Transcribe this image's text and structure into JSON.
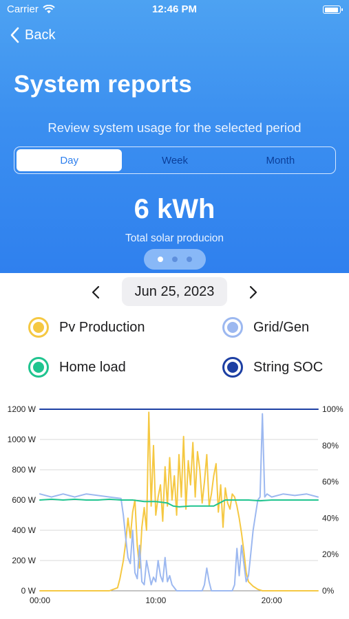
{
  "status_bar": {
    "carrier": "Carrier",
    "time": "12:46 PM"
  },
  "nav": {
    "back_label": "Back"
  },
  "header": {
    "title": "System reports",
    "subtitle": "Review system usage for the selected period"
  },
  "period_tabs": [
    {
      "label": "Day",
      "selected": true
    },
    {
      "label": "Week",
      "selected": false
    },
    {
      "label": "Month",
      "selected": false
    }
  ],
  "summary": {
    "value": "6 kWh",
    "caption": "Total solar producion",
    "page_index": 0,
    "page_count": 3
  },
  "date_picker": {
    "date": "Jun 25, 2023"
  },
  "legend": [
    {
      "label": "Pv Production",
      "color": "#f5c842"
    },
    {
      "label": "Grid/Gen",
      "color": "#9cb8f0"
    },
    {
      "label": "Home load",
      "color": "#1fc48f"
    },
    {
      "label": "String SOC",
      "color": "#1d3fa3"
    }
  ],
  "chart_data": {
    "type": "line",
    "title": "",
    "x_ticks": [
      "00:00",
      "10:00",
      "20:00"
    ],
    "xlim": [
      0,
      24
    ],
    "y_left_ticks": [
      "0 W",
      "200 W",
      "400 W",
      "600 W",
      "800 W",
      "1000 W",
      "1200 W"
    ],
    "ylim_left": [
      0,
      1200
    ],
    "y_right_ticks": [
      "0%",
      "20%",
      "40%",
      "60%",
      "80%",
      "100%"
    ],
    "ylim_right": [
      0,
      100
    ],
    "grid": true,
    "series": [
      {
        "name": "Pv Production",
        "color": "#f5c842",
        "axis": "left",
        "x": [
          0,
          6.0,
          6.7,
          6.9,
          7.2,
          7.4,
          7.6,
          7.8,
          8.0,
          8.2,
          8.4,
          8.6,
          8.8,
          9.0,
          9.2,
          9.4,
          9.6,
          9.8,
          10.0,
          10.2,
          10.4,
          10.6,
          10.8,
          11.0,
          11.2,
          11.4,
          11.6,
          11.8,
          12.0,
          12.2,
          12.4,
          12.6,
          12.8,
          13.0,
          13.2,
          13.4,
          13.6,
          13.8,
          14.0,
          14.2,
          14.4,
          14.6,
          14.8,
          15.0,
          15.2,
          15.4,
          15.6,
          15.8,
          16.0,
          16.2,
          16.4,
          16.6,
          16.8,
          17.0,
          17.2,
          17.4,
          17.6,
          17.8,
          18.0,
          18.4,
          18.8,
          19.2,
          19.6,
          20.0,
          24
        ],
        "y": [
          0,
          0,
          20,
          80,
          200,
          320,
          480,
          350,
          520,
          600,
          300,
          150,
          420,
          550,
          400,
          1180,
          560,
          960,
          500,
          620,
          700,
          460,
          820,
          560,
          880,
          600,
          760,
          500,
          900,
          620,
          1020,
          540,
          860,
          700,
          980,
          620,
          920,
          800,
          580,
          720,
          900,
          560,
          640,
          760,
          840,
          520,
          700,
          420,
          680,
          580,
          540,
          640,
          620,
          560,
          480,
          380,
          260,
          120,
          60,
          30,
          10,
          0,
          0,
          0,
          0
        ]
      },
      {
        "name": "Grid/Gen",
        "color": "#9cb8f0",
        "axis": "left",
        "x": [
          0,
          1,
          2,
          3,
          4,
          5,
          6,
          7,
          7.2,
          7.4,
          7.6,
          7.8,
          8.0,
          8.2,
          8.4,
          8.6,
          8.8,
          9.0,
          9.2,
          9.4,
          9.6,
          9.8,
          10.0,
          10.2,
          10.4,
          10.6,
          10.8,
          11.0,
          11.2,
          11.4,
          11.6,
          11.8,
          12.0,
          12.4,
          12.8,
          13.2,
          13.6,
          14.0,
          14.2,
          14.4,
          14.6,
          14.8,
          15.0,
          15.4,
          15.8,
          16.2,
          16.6,
          16.8,
          17.0,
          17.2,
          17.4,
          17.6,
          17.8,
          18.0,
          18.2,
          18.4,
          18.6,
          18.8,
          19.0,
          19.2,
          19.4,
          19.6,
          20.0,
          21,
          22,
          23,
          24
        ],
        "y": [
          640,
          620,
          640,
          620,
          640,
          630,
          620,
          610,
          500,
          350,
          220,
          180,
          400,
          120,
          80,
          300,
          60,
          40,
          200,
          120,
          40,
          90,
          60,
          200,
          100,
          60,
          220,
          60,
          100,
          40,
          20,
          0,
          0,
          0,
          0,
          0,
          0,
          0,
          40,
          150,
          60,
          0,
          0,
          0,
          0,
          0,
          0,
          40,
          280,
          100,
          300,
          180,
          60,
          100,
          250,
          400,
          500,
          600,
          620,
          1170,
          620,
          640,
          620,
          640,
          630,
          640,
          620
        ]
      },
      {
        "name": "Home load",
        "color": "#1fc48f",
        "axis": "left",
        "x": [
          0,
          1,
          2,
          3,
          4,
          5,
          6,
          7,
          8,
          9,
          10,
          10.5,
          11,
          11.5,
          12,
          13,
          14,
          15,
          16,
          17,
          18,
          19,
          20,
          21,
          22,
          23,
          24
        ],
        "y": [
          600,
          605,
          600,
          605,
          600,
          600,
          605,
          600,
          600,
          590,
          590,
          585,
          580,
          560,
          555,
          560,
          560,
          560,
          600,
          600,
          600,
          595,
          600,
          600,
          600,
          600,
          600
        ]
      },
      {
        "name": "String SOC",
        "color": "#1d3fa3",
        "axis": "right",
        "x": [
          0,
          24
        ],
        "y": [
          100,
          100
        ]
      }
    ]
  }
}
